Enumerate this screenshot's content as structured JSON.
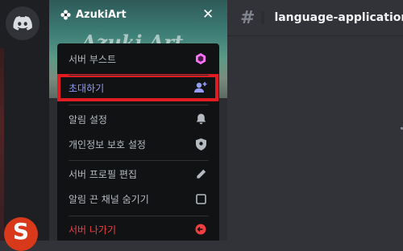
{
  "server": {
    "name": "AzukiArt",
    "banner_art_text": "Azuki Art"
  },
  "channel": {
    "name": "language-application"
  },
  "menu": {
    "items": [
      {
        "key": "boost",
        "label": "서버 부스트",
        "icon": "boost-gem-icon",
        "color": "#ff73fa"
      },
      {
        "key": "invite",
        "label": "초대하기",
        "icon": "add-user-icon",
        "color": "#949cf7",
        "highlighted": true
      },
      {
        "key": "notifications",
        "label": "알림 설정",
        "icon": "bell-icon"
      },
      {
        "key": "privacy",
        "label": "개인정보 보호 설정",
        "icon": "shield-icon"
      },
      {
        "key": "edit_profile",
        "label": "서버 프로필 편집",
        "icon": "pencil-icon"
      },
      {
        "key": "hide_muted",
        "label": "알림 끈 채널 숨기기",
        "icon": "checkbox-icon"
      },
      {
        "key": "leave",
        "label": "서버 나가기",
        "icon": "leave-icon",
        "color": "#f23f42"
      }
    ]
  },
  "colors": {
    "highlight_border": "#e11b22",
    "menu_bg": "#111214",
    "invite_text": "#949cf7",
    "leave_text": "#f23f42"
  }
}
